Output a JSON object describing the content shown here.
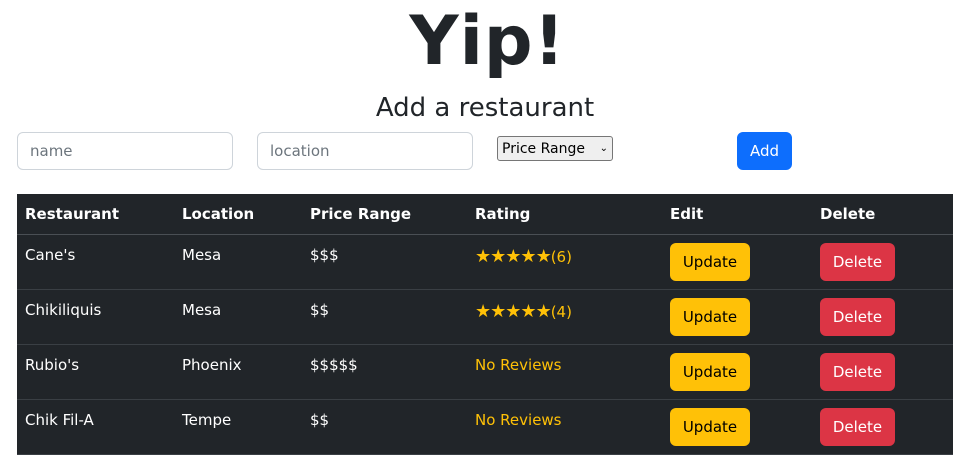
{
  "app": {
    "title": "Yip!"
  },
  "form": {
    "heading": "Add a restaurant",
    "name_placeholder": "name",
    "location_placeholder": "location",
    "price_select_label": "Price Range",
    "add_label": "Add"
  },
  "table": {
    "headers": [
      "Restaurant",
      "Location",
      "Price Range",
      "Rating",
      "Edit",
      "Delete"
    ],
    "rows": [
      {
        "restaurant": "Cane's",
        "location": "Mesa",
        "price": "$$$",
        "stars": 5,
        "review_count": "(6)",
        "rating_text": "",
        "update_label": "Update",
        "delete_label": "Delete"
      },
      {
        "restaurant": "Chikiliquis",
        "location": "Mesa",
        "price": "$$",
        "stars": 5,
        "review_count": "(4)",
        "rating_text": "",
        "update_label": "Update",
        "delete_label": "Delete"
      },
      {
        "restaurant": "Rubio's",
        "location": "Phoenix",
        "price": "$$$$$",
        "stars": 0,
        "review_count": "",
        "rating_text": "No Reviews",
        "update_label": "Update",
        "delete_label": "Delete"
      },
      {
        "restaurant": "Chik Fil-A",
        "location": "Tempe",
        "price": "$$",
        "stars": 0,
        "review_count": "",
        "rating_text": "No Reviews",
        "update_label": "Update",
        "delete_label": "Delete"
      }
    ]
  },
  "colors": {
    "add_button": "#0d6efd",
    "update_button": "#ffc107",
    "delete_button": "#dc3545",
    "table_background": "#212529",
    "rating": "#ffc107"
  },
  "icons": {
    "star": "star-icon",
    "dropdown": "chevron-down-icon"
  }
}
